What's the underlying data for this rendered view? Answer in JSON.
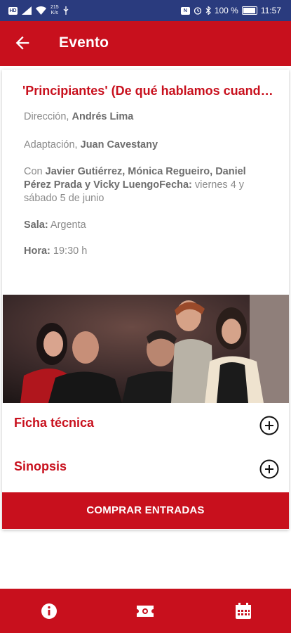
{
  "status_bar": {
    "speed_value": "215",
    "speed_unit": "K/s",
    "battery": "100 %",
    "time": "11:57"
  },
  "header": {
    "title": "Evento",
    "back_icon": "arrow-left-icon"
  },
  "event": {
    "title": "'Principiantes' (De qué hablamos cuando hablamos de amor)",
    "direccion_label": "Dirección,",
    "direccion_value": "Andrés Lima",
    "adaptacion_label": "Adaptación,",
    "adaptacion_value": "Juan Cavestany",
    "con_label": "Con",
    "con_value": "Javier Gutiérrez, Mónica Regueiro, Daniel Pérez Prada y Vicky LuengoFecha:",
    "fecha_value": "viernes 4 y sábado 5 de junio",
    "sala_label": "Sala:",
    "sala_value": "Argenta",
    "hora_label": "Hora:",
    "hora_value": "19:30 h"
  },
  "sections": [
    {
      "label": "Ficha técnica",
      "icon": "plus-circle-icon"
    },
    {
      "label": "Sinopsis",
      "icon": "plus-circle-icon"
    }
  ],
  "buy_button": {
    "label": "COMPRAR ENTRADAS"
  },
  "bottom_nav": [
    {
      "icon": "info-icon"
    },
    {
      "icon": "ticket-icon"
    },
    {
      "icon": "calendar-icon"
    }
  ],
  "colors": {
    "primary": "#c8101d",
    "status_bar": "#2a3b7e",
    "text_gray": "#8a8a8a"
  }
}
